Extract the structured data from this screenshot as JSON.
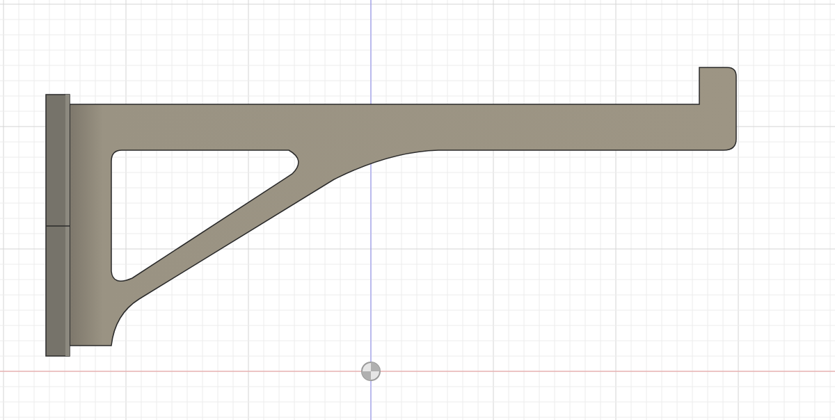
{
  "viewport": {
    "grid": true,
    "axes": true,
    "origin": true
  }
}
